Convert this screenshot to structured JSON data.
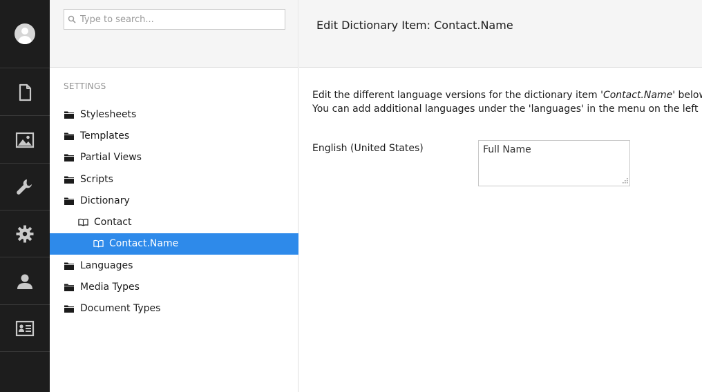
{
  "rail": {
    "items": [
      {
        "icon": "document-icon",
        "name": "Content"
      },
      {
        "icon": "image-icon",
        "name": "Media"
      },
      {
        "icon": "wrench-icon",
        "name": "Settings"
      },
      {
        "icon": "gear-icon",
        "name": "Developer"
      },
      {
        "icon": "user-icon",
        "name": "Users"
      },
      {
        "icon": "id-card-icon",
        "name": "Members"
      }
    ]
  },
  "search": {
    "placeholder": "Type to search..."
  },
  "tree": {
    "section_title": "SETTINGS",
    "items": [
      {
        "label": "Stylesheets",
        "icon": "folder-icon",
        "level": 0
      },
      {
        "label": "Templates",
        "icon": "folder-icon",
        "level": 0
      },
      {
        "label": "Partial Views",
        "icon": "folder-icon",
        "level": 0
      },
      {
        "label": "Scripts",
        "icon": "folder-icon",
        "level": 0
      },
      {
        "label": "Dictionary",
        "icon": "folder-icon",
        "level": 0
      },
      {
        "label": "Contact",
        "icon": "book-icon",
        "level": 1
      },
      {
        "label": "Contact.Name",
        "icon": "book-icon",
        "level": 2,
        "selected": true
      },
      {
        "label": "Languages",
        "icon": "folder-icon",
        "level": 0
      },
      {
        "label": "Media Types",
        "icon": "folder-icon",
        "level": 0
      },
      {
        "label": "Document Types",
        "icon": "folder-icon",
        "level": 0
      }
    ]
  },
  "editor": {
    "title": "Edit Dictionary Item: Contact.Name",
    "desc_line1_prefix": "Edit the different language versions for the dictionary item '",
    "desc_item": "Contact.Name",
    "desc_line1_suffix": "' below",
    "desc_line2": "You can add additional languages under the 'languages' in the menu on the left",
    "language_label": "English (United States)",
    "language_value": "Full Name"
  },
  "colors": {
    "rail_bg": "#1d1d1d",
    "selected_bg": "#2e8aea",
    "header_bg": "#f5f5f5"
  }
}
